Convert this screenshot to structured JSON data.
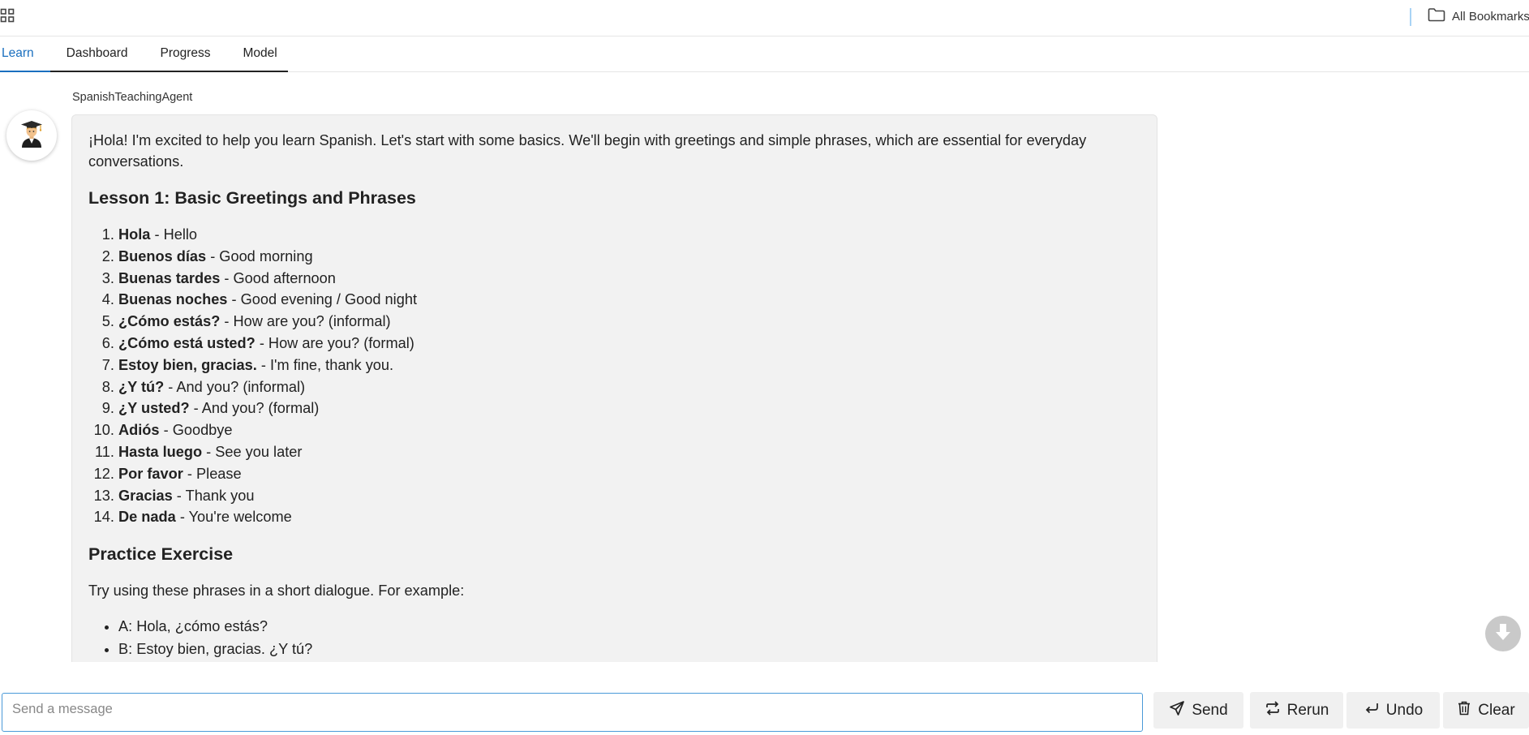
{
  "topbar": {
    "apps_icon": "apps-grid-icon",
    "bookmarks_label": "All Bookmarks",
    "bookmarks_icon": "folder-icon"
  },
  "tabs": [
    {
      "label": "Learn",
      "active": true
    },
    {
      "label": "Dashboard",
      "active": false
    },
    {
      "label": "Progress",
      "active": false
    },
    {
      "label": "Model",
      "active": false
    }
  ],
  "chat": {
    "agent_name": "SpanishTeachingAgent",
    "avatar_icon": "graduate-student-icon",
    "message": {
      "intro": "¡Hola! I'm excited to help you learn Spanish. Let's start with some basics. We'll begin with greetings and simple phrases, which are essential for everyday conversations.",
      "lesson_heading": "Lesson 1: Basic Greetings and Phrases",
      "phrases": [
        {
          "term": "Hola",
          "meaning": " - Hello"
        },
        {
          "term": "Buenos días",
          "meaning": " - Good morning"
        },
        {
          "term": "Buenas tardes",
          "meaning": " - Good afternoon"
        },
        {
          "term": "Buenas noches",
          "meaning": " - Good evening / Good night"
        },
        {
          "term": "¿Cómo estás?",
          "meaning": " - How are you? (informal)"
        },
        {
          "term": "¿Cómo está usted?",
          "meaning": " - How are you? (formal)"
        },
        {
          "term": "Estoy bien, gracias.",
          "meaning": " - I'm fine, thank you."
        },
        {
          "term": "¿Y tú?",
          "meaning": " - And you? (informal)"
        },
        {
          "term": "¿Y usted?",
          "meaning": " - And you? (formal)"
        },
        {
          "term": "Adiós",
          "meaning": " - Goodbye"
        },
        {
          "term": "Hasta luego",
          "meaning": " - See you later"
        },
        {
          "term": "Por favor",
          "meaning": " - Please"
        },
        {
          "term": "Gracias",
          "meaning": " - Thank you"
        },
        {
          "term": "De nada",
          "meaning": " - You're welcome"
        }
      ],
      "practice_heading": "Practice Exercise",
      "practice_text": "Try using these phrases in a short dialogue. For example:",
      "dialogue": [
        "A: Hola, ¿cómo estás?",
        "B: Estoy bien, gracias. ¿Y tú?"
      ]
    },
    "scroll_down_icon": "arrow-down-icon"
  },
  "input": {
    "placeholder": "Send a message",
    "value": ""
  },
  "buttons": {
    "send": {
      "label": "Send",
      "icon": "paper-plane-icon"
    },
    "rerun": {
      "label": "Rerun",
      "icon": "repeat-icon"
    },
    "undo": {
      "label": "Undo",
      "icon": "undo-arrow-icon"
    },
    "clear": {
      "label": "Clear",
      "icon": "trash-icon"
    }
  },
  "colors": {
    "accent": "#1a6fbf",
    "bubble_bg": "#f2f2f2",
    "input_border": "#4a9ad8"
  }
}
